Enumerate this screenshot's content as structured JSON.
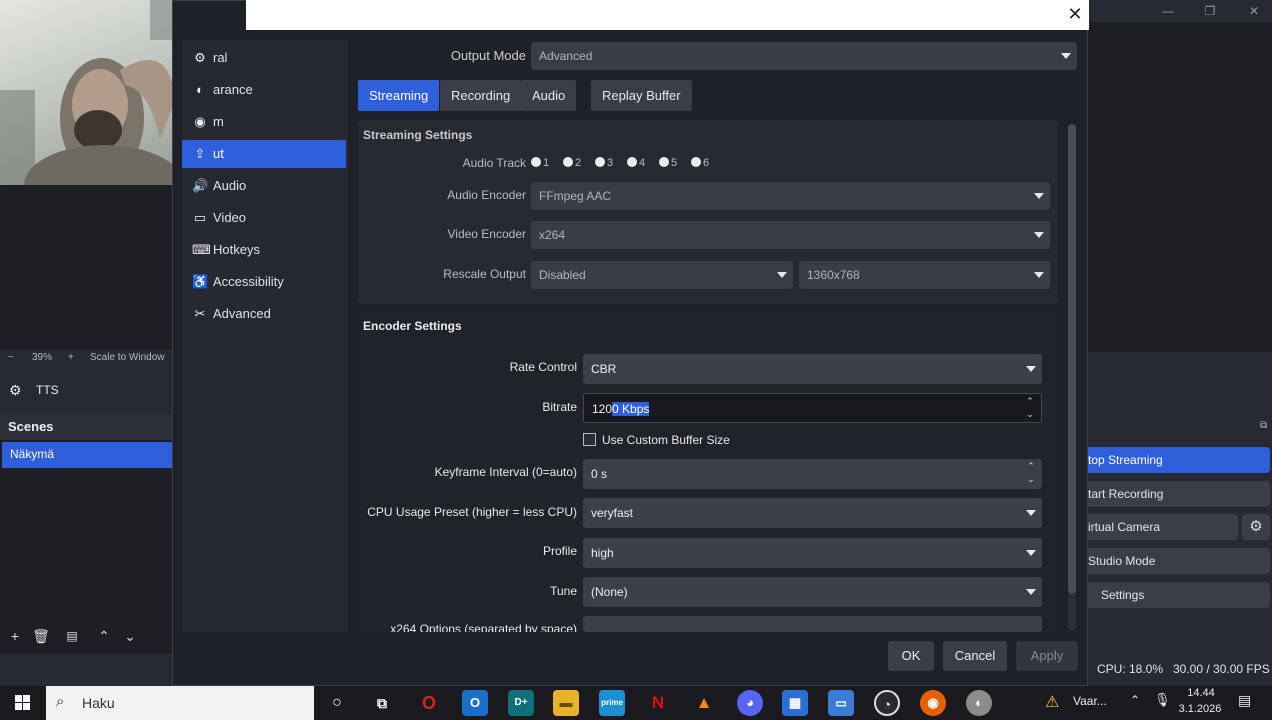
{
  "obs": {
    "preview_toolbar": {
      "zoom_minus": "−",
      "zoom": "39%",
      "zoom_plus": "+",
      "scale": "Scale to Window"
    },
    "source": {
      "label": "TTS"
    },
    "scenes": {
      "header": "Scenes",
      "items": [
        "Näkymä"
      ]
    },
    "controls": {
      "stop_streaming": "top Streaming",
      "start_recording": "tart Recording",
      "virtual_camera": "irtual Camera",
      "studio_mode": "Studio Mode",
      "settings": "Settings"
    },
    "status": {
      "cpu": "CPU: 18.0%",
      "fps": "30.00 / 30.00 FPS"
    }
  },
  "dialog": {
    "sidebar": {
      "items": [
        {
          "label": "ral",
          "icon": "general-icon"
        },
        {
          "label": "arance",
          "icon": "appearance-icon"
        },
        {
          "label": "m",
          "icon": "stream-icon"
        },
        {
          "label": "ut",
          "icon": "output-icon"
        },
        {
          "label": "Audio",
          "icon": "audio-icon"
        },
        {
          "label": "Video",
          "icon": "video-icon"
        },
        {
          "label": "Hotkeys",
          "icon": "keyboard-icon"
        },
        {
          "label": "Accessibility",
          "icon": "accessibility-icon"
        },
        {
          "label": "Advanced",
          "icon": "tools-icon"
        }
      ]
    },
    "output_mode": {
      "label": "Output Mode",
      "value": "Advanced"
    },
    "tabs": [
      "Streaming",
      "Recording",
      "Audio",
      "Replay Buffer"
    ],
    "streaming_settings": {
      "title": "Streaming Settings",
      "audio_track_label": "Audio Track",
      "tracks": [
        "1",
        "2",
        "3",
        "4",
        "5",
        "6"
      ],
      "audio_encoder": {
        "label": "Audio Encoder",
        "value": "FFmpeg AAC"
      },
      "video_encoder": {
        "label": "Video Encoder",
        "value": "x264"
      },
      "rescale_output": {
        "label": "Rescale Output",
        "value": "Disabled",
        "resolution": "1360x768"
      }
    },
    "encoder_settings": {
      "title": "Encoder Settings",
      "rate_control": {
        "label": "Rate Control",
        "value": "CBR"
      },
      "bitrate": {
        "label": "Bitrate",
        "value_prefix": "120",
        "value_selected": "0 Kbps"
      },
      "custom_buffer": {
        "label": "Use Custom Buffer Size",
        "checked": false
      },
      "keyframe": {
        "label": "Keyframe Interval (0=auto)",
        "value": "0 s"
      },
      "cpu_preset": {
        "label": "CPU Usage Preset (higher = less CPU)",
        "value": "veryfast"
      },
      "profile": {
        "label": "Profile",
        "value": "high"
      },
      "tune": {
        "label": "Tune",
        "value": "(None)"
      },
      "x264_options": {
        "label": "x264 Options (separated by space)",
        "value": ""
      }
    },
    "buttons": {
      "ok": "OK",
      "cancel": "Cancel",
      "apply": "Apply"
    }
  },
  "taskbar": {
    "search_placeholder": "Haku",
    "tray_text": "Vaar...",
    "time": "14.44",
    "date": "3.1.2026"
  },
  "colors": {
    "accent": "#2f5fda",
    "dialog_bg": "#1f2128",
    "panel": "#272a33"
  }
}
